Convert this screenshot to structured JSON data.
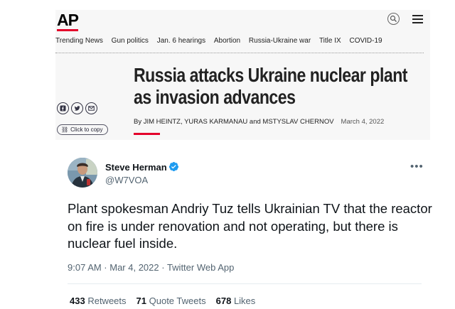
{
  "article": {
    "logo": "AP",
    "nav": [
      "Trending News",
      "Gun politics",
      "Jan. 6 hearings",
      "Abortion",
      "Russia-Ukraine war",
      "Title IX",
      "COVID-19"
    ],
    "headline": "Russia attacks Ukraine nuclear plant as invasion advances",
    "byline": "By JIM HEINTZ, YURAS KARMANAU and MSTYSLAV CHERNOV",
    "date": "March 4, 2022",
    "copy_label": "Click to copy",
    "accent_color": "#e4002b"
  },
  "tweet": {
    "name": "Steve Herman",
    "handle": "@W7VOA",
    "more": "•••",
    "text": "Plant spokesman Andriy Tuz tells Ukrainian TV that the reactor on fire is under renovation and not operating, but there is nuclear fuel inside.",
    "meta": "9:07 AM · Mar 4, 2022 · Twitter Web App",
    "stats": {
      "retweets_count": "433",
      "retweets_label": "Retweets",
      "quotes_count": "71",
      "quotes_label": "Quote Tweets",
      "likes_count": "678",
      "likes_label": "Likes"
    },
    "verified_color": "#1d9bf0"
  }
}
